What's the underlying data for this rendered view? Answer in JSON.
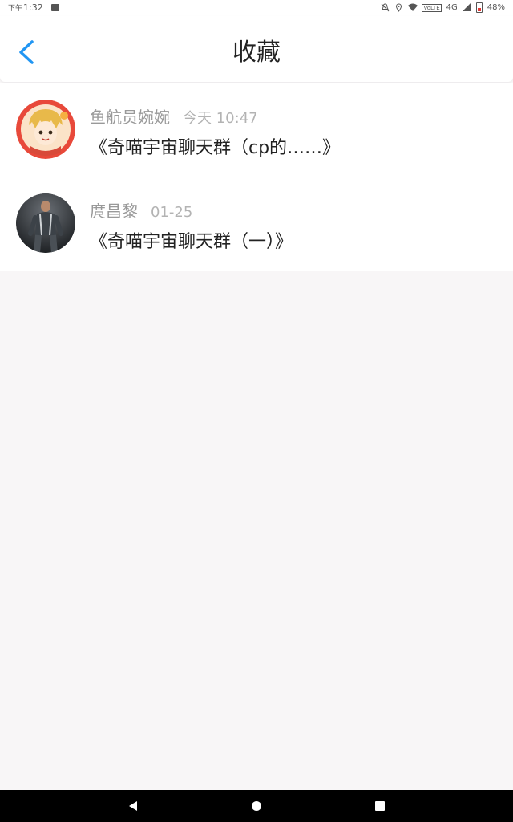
{
  "status_bar": {
    "ampm": "下午",
    "time": "1:32",
    "network": "4G",
    "volte": "VoLTE",
    "battery": "48%"
  },
  "header": {
    "title": "收藏"
  },
  "favorites": [
    {
      "name": "鱼航员婉婉",
      "time": "今天 10:47",
      "title": "《奇喵宇宙聊天群（cp的……》"
    },
    {
      "name": "庹昌黎",
      "time": "01-25",
      "title": "《奇喵宇宙聊天群（一）》"
    }
  ],
  "colors": {
    "accent": "#2196f3",
    "background": "#f8f6f7"
  }
}
